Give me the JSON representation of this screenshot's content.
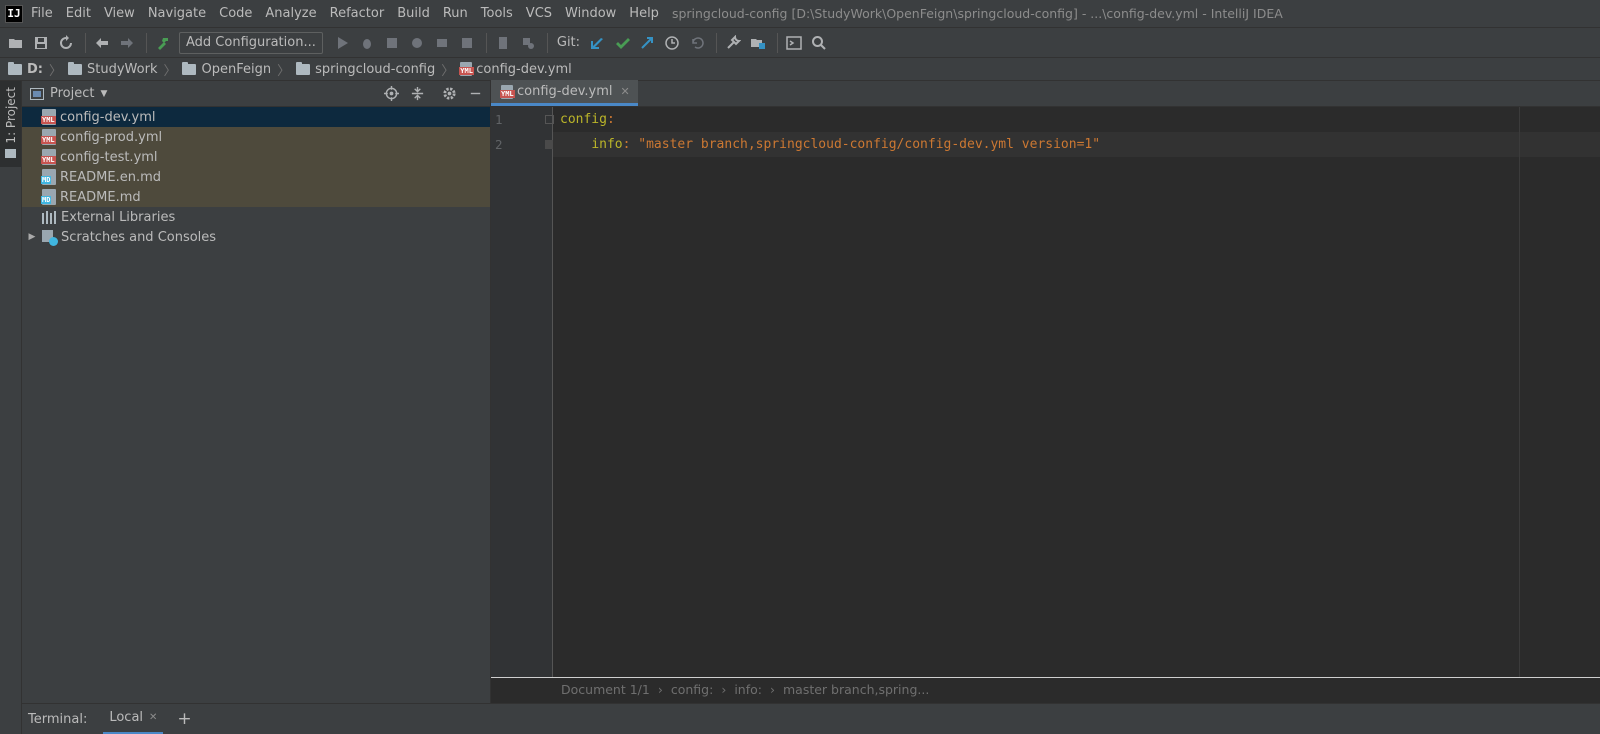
{
  "menu": {
    "logo": "IJ",
    "items": [
      {
        "label": "File"
      },
      {
        "label": "Edit"
      },
      {
        "label": "View"
      },
      {
        "label": "Navigate"
      },
      {
        "label": "Code"
      },
      {
        "label": "Analyze"
      },
      {
        "label": "Refactor"
      },
      {
        "label": "Build"
      },
      {
        "label": "Run"
      },
      {
        "label": "Tools"
      },
      {
        "label": "VCS"
      },
      {
        "label": "Window"
      },
      {
        "label": "Help"
      }
    ],
    "window_title": "springcloud-config [D:\\StudyWork\\OpenFeign\\springcloud-config] - ...\\config-dev.yml - IntelliJ IDEA"
  },
  "toolbar": {
    "run_config_label": "Add Configuration...",
    "git_label": "Git:",
    "colors": {
      "hammer": "#499c54",
      "git_update": "#3592c4",
      "git_commit": "#499c54",
      "disabled": "#6f737a",
      "normal": "#afb1b3"
    }
  },
  "navbar": {
    "crumbs": [
      {
        "label": "D:"
      },
      {
        "label": "StudyWork"
      },
      {
        "label": "OpenFeign"
      },
      {
        "label": "springcloud-config"
      },
      {
        "label": "config-dev.yml"
      }
    ]
  },
  "left_stripe": {
    "project_tab_label": "1: Project"
  },
  "project_panel": {
    "title": "Project",
    "tree": [
      {
        "label": "config-dev.yml",
        "type": "yml",
        "state": "selected"
      },
      {
        "label": "config-prod.yml",
        "type": "yml",
        "state": "modified"
      },
      {
        "label": "config-test.yml",
        "type": "yml",
        "state": "modified"
      },
      {
        "label": "README.en.md",
        "type": "md",
        "state": "modified"
      },
      {
        "label": "README.md",
        "type": "md",
        "state": "modified"
      },
      {
        "label": "External Libraries",
        "type": "lib",
        "state": "normal"
      },
      {
        "label": "Scratches and Consoles",
        "type": "scratch",
        "state": "normal"
      }
    ]
  },
  "editor": {
    "tab_label": "config-dev.yml",
    "lines": [
      {
        "number": "1",
        "key": "config",
        "colon": ":",
        "value": ""
      },
      {
        "number": "2",
        "key": "info",
        "colon": ":",
        "value": "\"master branch,springcloud-config/config-dev.yml version=1\""
      }
    ],
    "breadcrumbs": [
      "Document 1/1",
      "config:",
      "info:",
      "master branch,spring..."
    ]
  },
  "terminal": {
    "label": "Terminal:",
    "tab_label": "Local"
  }
}
